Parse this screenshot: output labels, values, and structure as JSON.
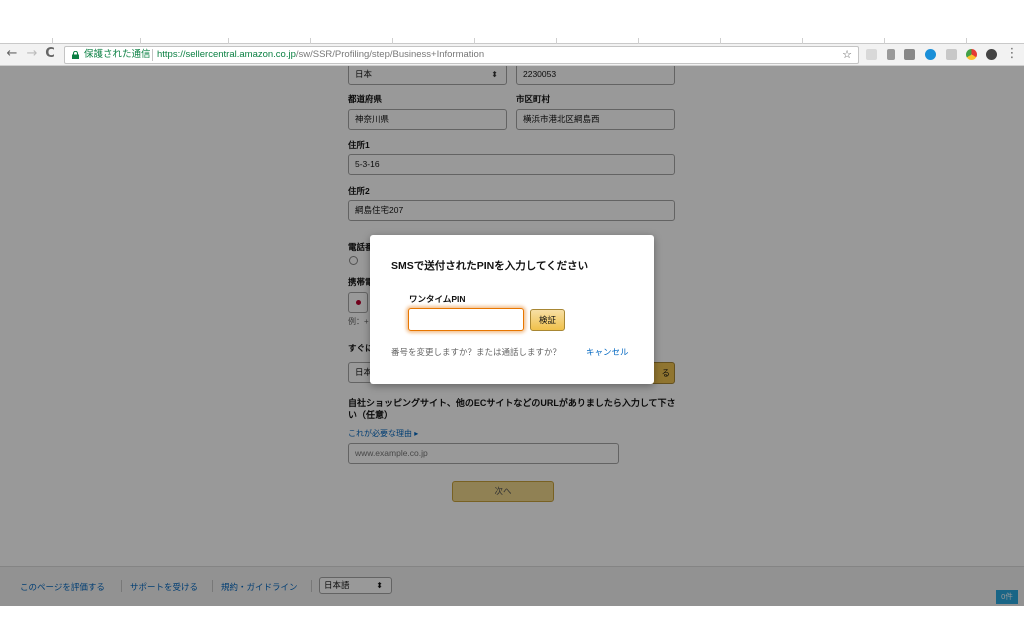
{
  "browser": {
    "secure_label": "保護された通信",
    "url_scheme_host": "https://sellercentral.amazon.co.jp",
    "url_path": "/sw/SSR/Profiling/step/Business+Information",
    "back_icon": "←",
    "forward_icon": "→",
    "reload_icon": "C",
    "star_icon": "☆",
    "menu_icon": "⋮"
  },
  "form": {
    "country_value": "日本",
    "postal_value": "2230053",
    "prefecture_label": "都道府県",
    "prefecture_value": "神奈川県",
    "city_label": "市区町村",
    "city_value": "横浜市港北区綱島西",
    "address1_label": "住所1",
    "address1_value": "5-3-16",
    "address2_label": "住所2",
    "address2_value": "綱島住宅207",
    "phone_label_partial": "電話番",
    "mobile_label_partial": "携帯電",
    "example_partial": "例：+",
    "immediate_label_partial": "すぐに",
    "language_partial": "日本",
    "side_button_partial": "る",
    "website_label": "自社ショッピングサイト、他のECサイトなどのURLがありましたら入力して下さい（任意）",
    "why_link": "これが必要な理由",
    "website_placeholder": "www.example.co.jp",
    "next_button": "次へ"
  },
  "footer": {
    "rate_link": "このページを評価する",
    "support_link": "サポートを受ける",
    "terms_link": "規約・ガイドライン",
    "language_value": "日本語",
    "count_badge": "0件"
  },
  "modal": {
    "title": "SMSで送付されたPINを入力してください",
    "pin_label": "ワンタイムPIN",
    "pin_value": "",
    "verify_button": "検証",
    "note": "番号を変更しますか？または通話しますか？",
    "cancel_link": "キャンセル"
  },
  "colors": {
    "accent_link": "#0066c0",
    "secure_green": "#0b8043",
    "button_gold": "#f0c14b",
    "focus_orange": "#e77600"
  }
}
